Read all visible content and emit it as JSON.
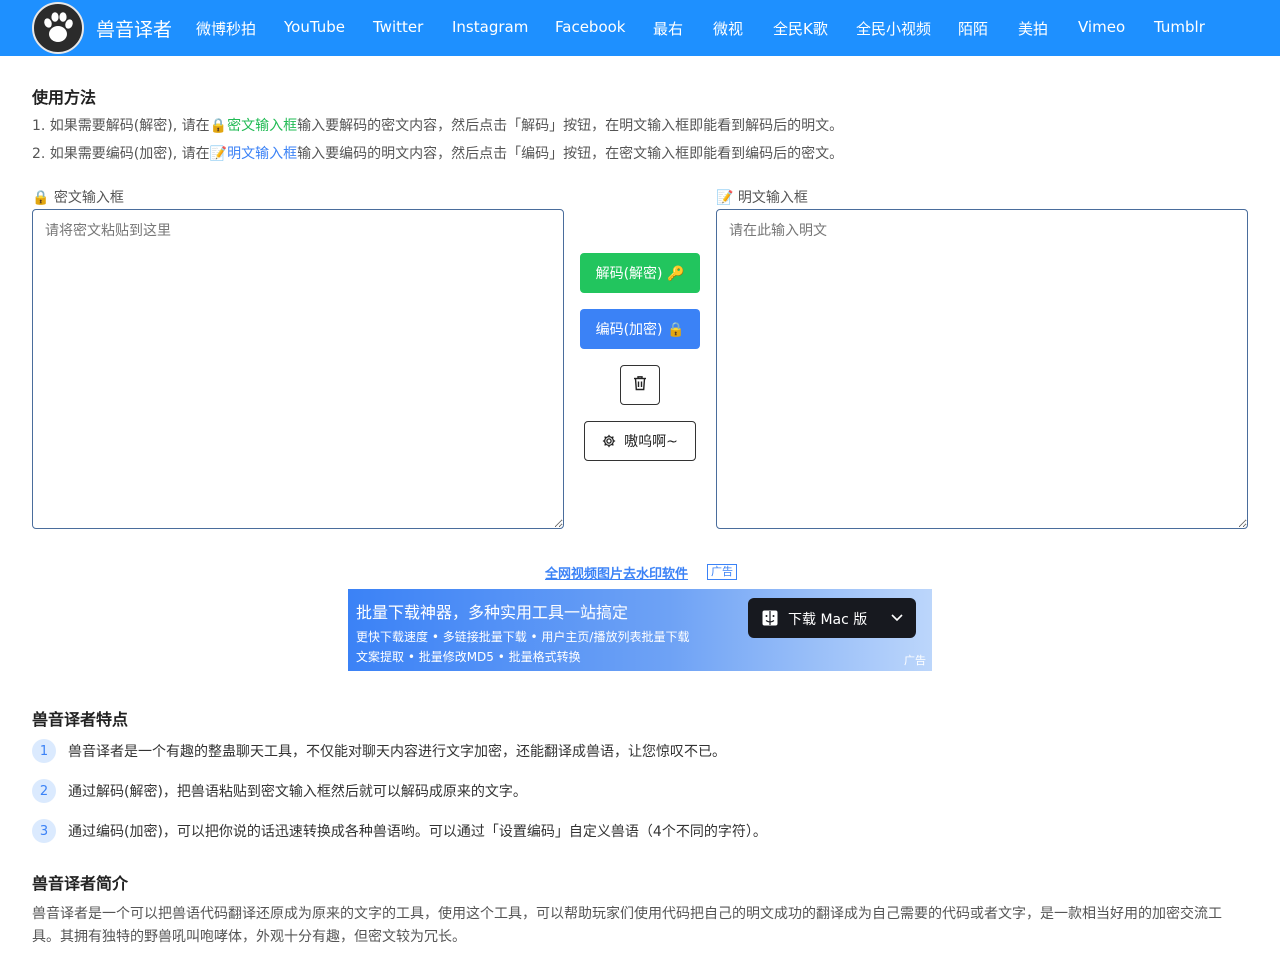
{
  "nav": {
    "brand": "兽音译者",
    "items": [
      "微博秒拍",
      "YouTube",
      "Twitter",
      "Instagram",
      "Facebook",
      "最右",
      "微视",
      "全民K歌",
      "全民小视频",
      "陌陌",
      "美拍",
      "Vimeo",
      "Tumblr"
    ]
  },
  "usage": {
    "title": "使用方法",
    "line1": {
      "a": "1. 如果需要解码(解密), 请在",
      "link": "🔒密文输入框",
      "b": "输入要解码的密文内容，然后点击「解码」按钮，在明文输入框即能看到解码后的明文。"
    },
    "line2": {
      "a": "2. 如果需要编码(加密), 请在",
      "link": "📝明文输入框",
      "b": "输入要编码的明文内容，然后点击「编码」按钮，在密文输入框即能看到编码后的密文。"
    }
  },
  "cipher": {
    "label": "🔒 密文输入框",
    "placeholder": "请将密文粘贴到这里",
    "value": ""
  },
  "plain": {
    "label": "📝 明文输入框",
    "placeholder": "请在此输入明文",
    "value": ""
  },
  "buttons": {
    "decode": "解码(解密) 🔑",
    "encode": "编码(加密) 🔒",
    "clear_icon": "trash-icon",
    "settings": "嗷呜啊~",
    "settings_icon": "gear-icon"
  },
  "ad": {
    "link": "全网视频图片去水印软件",
    "tag": "广告",
    "banner_title": "批量下载神器，多种实用工具一站搞定",
    "banner_line1": "更快下载速度  •  多链接批量下载  •  用户主页/播放列表批量下载",
    "banner_line2": "文案提取  •  批量修改MD5  •  批量格式转换",
    "download_button": "下载 Mac 版",
    "banner_tag": "广告"
  },
  "features": {
    "title": "兽音译者特点",
    "items": [
      {
        "num": "1",
        "text": "兽音译者是一个有趣的整蛊聊天工具，不仅能对聊天内容进行文字加密，还能翻译成兽语，让您惊叹不已。"
      },
      {
        "num": "2",
        "text": "通过解码(解密)，把兽语粘贴到密文输入框然后就可以解码成原来的文字。"
      },
      {
        "num": "3",
        "text": "通过编码(加密)，可以把你说的话迅速转换成各种兽语哟。可以通过「设置编码」自定义兽语（4个不同的字符）。"
      }
    ]
  },
  "intro": {
    "title": "兽音译者简介",
    "text": "兽音译者是一个可以把兽语代码翻译还原成为原来的文字的工具，使用这个工具，可以帮助玩家们使用代码把自己的明文成功的翻译成为自己需要的代码或者文字，是一款相当好用的加密交流工具。其拥有独特的野兽吼叫咆哮体，外观十分有趣，但密文较为冗长。"
  },
  "colors": {
    "nav_bg": "#1e90ff",
    "green": "#22c55e",
    "blue": "#3b82f6"
  }
}
